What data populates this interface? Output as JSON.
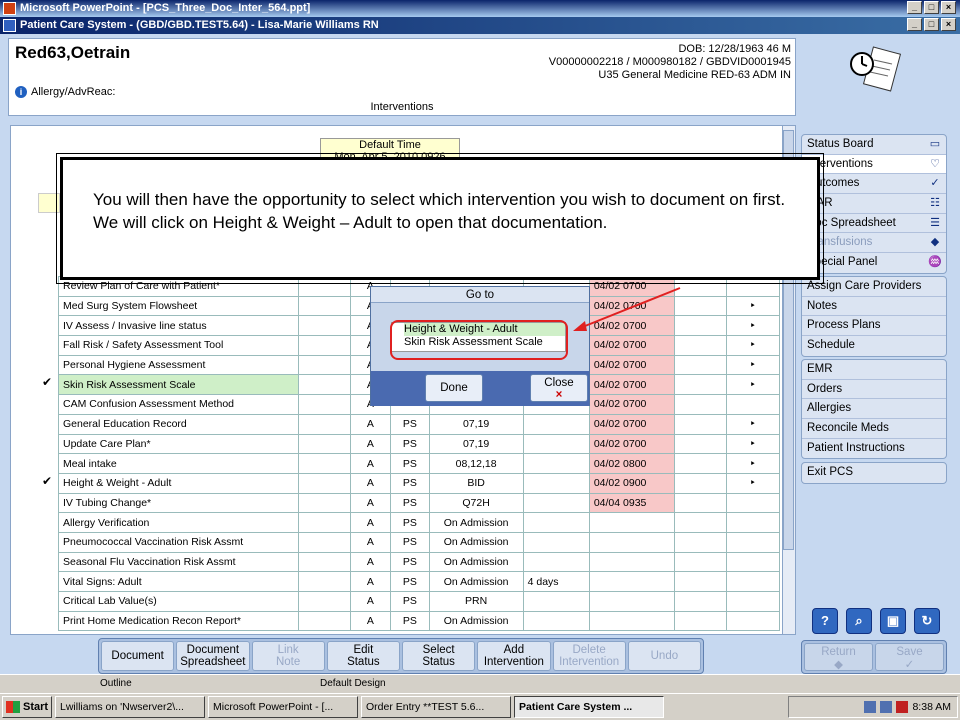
{
  "window": {
    "ppt_title": "Microsoft PowerPoint - [PCS_Three_Doc_Inter_564.ppt]",
    "app_title": "Patient Care System - (GBD/GBD.TEST5.64) - Lisa-Marie Williams RN",
    "min": "_",
    "max": "□",
    "close": "×"
  },
  "patient": {
    "name": "Red63,Oetrain",
    "dob": "DOB: 12/28/1963 46 M",
    "ids": "V00000002218 / M000980182 / GBDVID0001945",
    "location": "U35 General Medicine  RED-63  ADM IN",
    "allergy": "Allergy/AdvReac:",
    "section": "Interventions"
  },
  "default_time": {
    "label": "Default Time",
    "value": "Mon, Apr 5, 2010  0926"
  },
  "rows": [
    {
      "name": "Review Plan of Care with Patient*",
      "a": "A",
      "ps": "",
      "freq": "",
      "extra": "",
      "time": "04/02 0700",
      "arrow": ""
    },
    {
      "name": "Med Surg System Flowsheet",
      "a": "A",
      "ps": "",
      "freq": "",
      "extra": "",
      "time": "04/02 0700",
      "arrow": "‣"
    },
    {
      "name": "IV Assess / Invasive line status",
      "a": "A",
      "ps": "",
      "freq": "",
      "extra": "",
      "time": "04/02 0700",
      "arrow": "‣"
    },
    {
      "name": "Fall Risk / Safety Assessment Tool",
      "a": "A",
      "ps": "",
      "freq": "",
      "extra": "",
      "time": "04/02 0700",
      "arrow": "‣"
    },
    {
      "name": "Personal Hygiene Assessment",
      "a": "A",
      "ps": "",
      "freq": "",
      "extra": "",
      "time": "04/02 0700",
      "arrow": "‣"
    },
    {
      "name": "Skin Risk Assessment Scale",
      "a": "A",
      "ps": "",
      "freq": "",
      "extra": "",
      "time": "04/02 0700",
      "arrow": "‣"
    },
    {
      "name": "CAM Confusion Assessment Method",
      "a": "A",
      "ps": "",
      "freq": "",
      "extra": "",
      "time": "04/02 0700",
      "arrow": ""
    },
    {
      "name": "General Education Record",
      "a": "A",
      "ps": "PS",
      "freq": "07,19",
      "extra": "",
      "time": "04/02 0700",
      "arrow": "‣"
    },
    {
      "name": "Update Care Plan*",
      "a": "A",
      "ps": "PS",
      "freq": "07,19",
      "extra": "",
      "time": "04/02 0700",
      "arrow": "‣"
    },
    {
      "name": "Meal intake",
      "a": "A",
      "ps": "PS",
      "freq": "08,12,18",
      "extra": "",
      "time": "04/02 0800",
      "arrow": "‣"
    },
    {
      "name": "Height & Weight - Adult",
      "a": "A",
      "ps": "PS",
      "freq": "BID",
      "extra": "",
      "time": "04/02 0900",
      "arrow": "‣"
    },
    {
      "name": "IV Tubing Change*",
      "a": "A",
      "ps": "PS",
      "freq": "Q72H",
      "extra": "",
      "time": "04/04 0935",
      "arrow": ""
    },
    {
      "name": "Allergy Verification",
      "a": "A",
      "ps": "PS",
      "freq": "On Admission",
      "extra": "",
      "time": "",
      "arrow": ""
    },
    {
      "name": "Pneumococcal Vaccination Risk Assmt",
      "a": "A",
      "ps": "PS",
      "freq": "On Admission",
      "extra": "",
      "time": "",
      "arrow": ""
    },
    {
      "name": "Seasonal Flu Vaccination Risk Assmt",
      "a": "A",
      "ps": "PS",
      "freq": "On Admission",
      "extra": "",
      "time": "",
      "arrow": ""
    },
    {
      "name": "Vital Signs: Adult",
      "a": "A",
      "ps": "PS",
      "freq": "On Admission",
      "extra": "4 days",
      "time": "",
      "arrow": ""
    },
    {
      "name": "Critical Lab Value(s)",
      "a": "A",
      "ps": "PS",
      "freq": "PRN",
      "extra": "",
      "time": "",
      "arrow": ""
    },
    {
      "name": "Print Home Medication Recon Report*",
      "a": "A",
      "ps": "PS",
      "freq": "On Admission",
      "extra": "",
      "time": "",
      "arrow": ""
    }
  ],
  "checks": {
    "skin": "✔",
    "height": "✔"
  },
  "nav1": [
    "Status Board",
    "Interventions",
    "Outcomes",
    "MAR",
    "Doc Spreadsheet",
    "Transfusions",
    "Special Panel"
  ],
  "nav2": [
    "Assign Care Providers",
    "Notes",
    "Process Plans",
    "Schedule"
  ],
  "nav3": [
    "EMR",
    "Orders",
    "Allergies",
    "Reconcile Meds",
    "Patient Instructions"
  ],
  "nav4": [
    "Exit PCS"
  ],
  "toolbar": [
    {
      "l1": "Document",
      "l2": ""
    },
    {
      "l1": "Document",
      "l2": "Spreadsheet"
    },
    {
      "l1": "Link",
      "l2": "Note"
    },
    {
      "l1": "Edit",
      "l2": "Status"
    },
    {
      "l1": "Select",
      "l2": "Status"
    },
    {
      "l1": "Add",
      "l2": "Intervention"
    },
    {
      "l1": "Delete",
      "l2": "Intervention"
    },
    {
      "l1": "Undo",
      "l2": ""
    }
  ],
  "return_label": "Return",
  "save_label": "Save",
  "popup": {
    "title": "Go to",
    "item1": "Height & Weight - Adult",
    "item2": "Skin Risk Assessment Scale",
    "done": "Done",
    "close": "Close"
  },
  "callout": "You will then have the opportunity to select which intervention you wish to document on first. We will click on Height & Weight – Adult to open that documentation.",
  "ppt": {
    "outline": "Outline",
    "design": "Default Design"
  },
  "taskbar": {
    "start": "Start",
    "t1": "Lwilliams on 'Nwserver2\\...",
    "t2": "Microsoft PowerPoint - [...",
    "t3": "Order Entry **TEST 5.6...",
    "t4": "Patient Care System ...",
    "clock": "8:38 AM"
  },
  "colors": {
    "time_cell": "#f8c8c8",
    "highlight": "#cfefc8",
    "callout_border": "#000000"
  }
}
